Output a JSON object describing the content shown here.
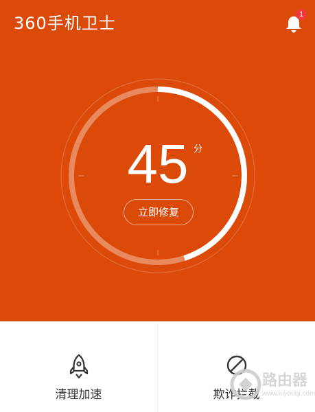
{
  "app": {
    "title": "360手机卫士"
  },
  "notifications": {
    "badge_count": "1",
    "icon": "bell-icon"
  },
  "security": {
    "score": "45",
    "unit": "分",
    "score_fraction": 0.45,
    "fix_button_label": "立即修复"
  },
  "actions": [
    {
      "label": "清理加速",
      "icon": "rocket-icon"
    },
    {
      "label": "欺诈拦截",
      "icon": "block-icon"
    }
  ],
  "watermark": {
    "text": "路由器",
    "sub": "www.luyouqi.com"
  },
  "colors": {
    "primary": "#dc4a09",
    "accent_text": "#ffffff",
    "badge": "#f03a3a"
  }
}
